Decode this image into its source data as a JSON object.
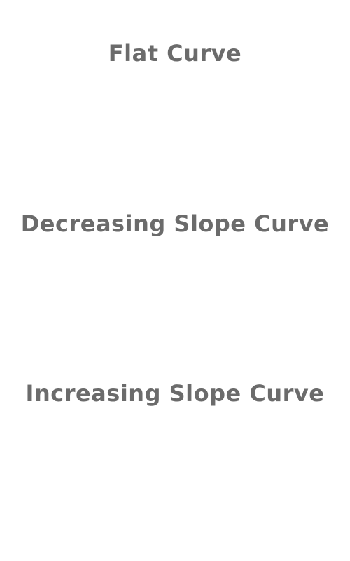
{
  "headings": {
    "flat": "Flat Curve",
    "decreasing": "Decreasing Slope Curve",
    "increasing": "Increasing Slope Curve"
  },
  "colors": {
    "heading_text": "#6b6b6b",
    "background": "#ffffff"
  }
}
